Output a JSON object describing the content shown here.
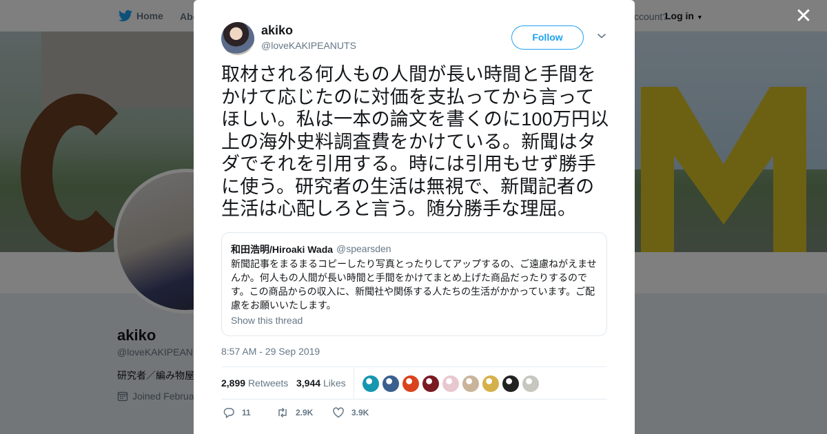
{
  "nav": {
    "home_label": "Home",
    "about_label": "Abo",
    "account_prompt": "ccount?",
    "login_label": "Log in"
  },
  "profile": {
    "name": "akiko",
    "handle": "@loveKAKIPEANU",
    "bio": "研究者／編み物屋",
    "joined": "Joined Februa"
  },
  "tweet": {
    "author_name": "akiko",
    "author_handle": "@loveKAKIPEANUTS",
    "follow_label": "Follow",
    "text": "取材される何人もの人間が長い時間と手間をかけて応じたのに対価を支払ってから言ってほしい。私は一本の論文を書くのに100万円以上の海外史料調査費をかけている。新聞はタダでそれを引用する。時には引用もせず勝手に使う。研究者の生活は無視で、新聞記者の生活は心配しろと言う。随分勝手な理屈。",
    "timestamp": "8:57 AM - 29 Sep 2019",
    "retweets_count": "2,899",
    "retweets_label": "Retweets",
    "likes_count": "3,944",
    "likes_label": "Likes",
    "reply_count": "11",
    "retweet_action_count": "2.9K",
    "like_action_count": "3.9K"
  },
  "quote": {
    "name": "和田浩明/Hiroaki Wada",
    "handle": "@spearsden",
    "text": "新聞記事をまるまるコピーしたり写真とったりしてアップするの、ご遠慮ねがえませんか。何人もの人間が長い時間と手間をかけてまとめ上げた商品だったりするのです。この商品からの収入に、新聞社や関係する人たちの生活がかかっています。ご配慮をお願いいたします。",
    "show_thread": "Show this thread"
  },
  "likers": [
    {
      "icon": "teal-avatar",
      "color": "#1796b0"
    },
    {
      "icon": "blue-figure-avatar",
      "color": "#3b5f8f"
    },
    {
      "icon": "red-avatar",
      "color": "#d9431e"
    },
    {
      "icon": "anime-dark-avatar",
      "color": "#7a1a22"
    },
    {
      "icon": "pink-avatar",
      "color": "#e8c8d0"
    },
    {
      "icon": "anime-girl-avatar",
      "color": "#c9b49a"
    },
    {
      "icon": "food-avatar",
      "color": "#d6b04a"
    },
    {
      "icon": "black-avatar",
      "color": "#222222"
    },
    {
      "icon": "grey-avatar",
      "color": "#c7c7c0"
    }
  ],
  "colors": {
    "accent": "#1da1f2",
    "muted": "#657786",
    "text": "#14171a"
  }
}
